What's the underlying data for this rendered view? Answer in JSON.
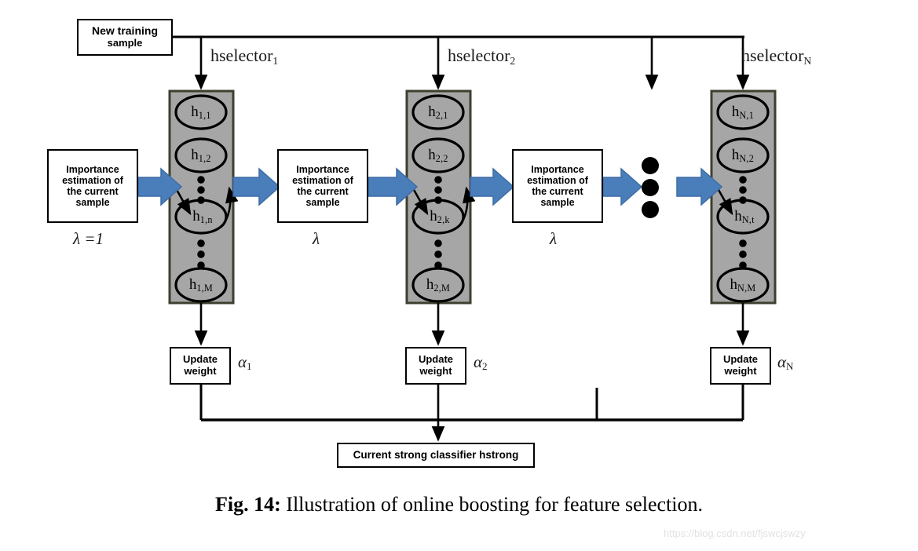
{
  "figure": {
    "caption_number": "Fig. 14:",
    "caption_text": " Illustration of online boosting for feature selection.",
    "watermark": "https://blog.csdn.net/fjswcjswzy"
  },
  "colors": {
    "arrow_blue": "#4a7ebb",
    "arrow_blue_stroke": "#3c6ca5",
    "column_gray": "#a6a6a6",
    "column_border": "#3f3f2f",
    "line_black": "#000000",
    "watermark_gray": "#e2e2e2"
  },
  "boxes": {
    "new_training_sample": {
      "line1": "New training",
      "line2": "sample"
    },
    "importance_estimation": {
      "line1": "Importance",
      "line2": "estimation of",
      "line3": "the current",
      "line4": "sample"
    },
    "update_weight": {
      "line1": "Update",
      "line2": "weight"
    },
    "strong_classifier": "Current strong classifier hstrong"
  },
  "selectors": [
    {
      "label_base": "hselector",
      "label_sub": "1",
      "lambda": "λ",
      "lambda_value": " =1",
      "alpha_base": "α",
      "alpha_sub": "1",
      "nodes": [
        {
          "base": "h",
          "sub": "1,1"
        },
        {
          "base": "h",
          "sub": "1,2"
        },
        {
          "base": "h",
          "sub": "1,n"
        },
        {
          "base": "h",
          "sub": "1,M"
        }
      ]
    },
    {
      "label_base": "hselector",
      "label_sub": "2",
      "lambda": "λ",
      "lambda_value": "",
      "alpha_base": "α",
      "alpha_sub": "2",
      "nodes": [
        {
          "base": "h",
          "sub": "2,1"
        },
        {
          "base": "h",
          "sub": "2,2"
        },
        {
          "base": "h",
          "sub": "2,k"
        },
        {
          "base": "h",
          "sub": "2,M"
        }
      ]
    },
    {
      "label_base": "hselector",
      "label_sub": "N",
      "lambda": "λ",
      "lambda_value": "",
      "alpha_base": "α",
      "alpha_sub": "N",
      "nodes": [
        {
          "base": "h",
          "sub": "N,1"
        },
        {
          "base": "h",
          "sub": "N,2"
        },
        {
          "base": "h",
          "sub": "N,t"
        },
        {
          "base": "h",
          "sub": "N,M"
        }
      ]
    }
  ],
  "ellipsis": {
    "horizontal_dots_count": 3,
    "vertical_dots_count_per_gap": 3
  }
}
